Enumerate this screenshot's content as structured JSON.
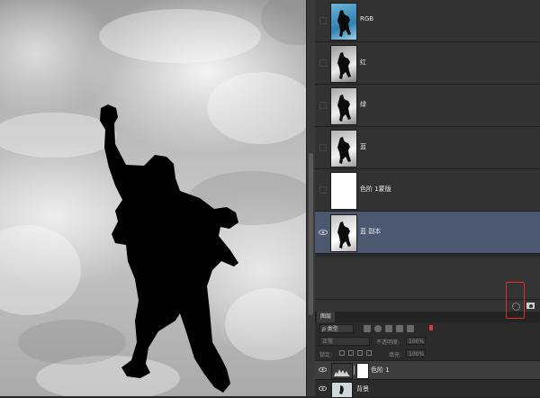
{
  "channels": [
    {
      "name": "RGB",
      "visible": false,
      "selected": false
    },
    {
      "name": "红",
      "visible": false,
      "selected": false
    },
    {
      "name": "绿",
      "visible": false,
      "selected": false
    },
    {
      "name": "蓝",
      "visible": false,
      "selected": false
    },
    {
      "name": "色阶 1蒙版",
      "visible": false,
      "selected": false
    },
    {
      "name": "蓝 副本",
      "visible": true,
      "selected": true
    }
  ],
  "layers_panel": {
    "tab_label": "图层",
    "filter_kind": "ρ 类型",
    "blend_mode": "正常",
    "opacity_label": "不透明度:",
    "opacity_value": "100%",
    "lock_label": "锁定:",
    "fill_label": "填充:",
    "fill_value": "100%",
    "layers": [
      {
        "name": "色阶 1",
        "selected": true
      },
      {
        "name": "背景",
        "selected": false
      }
    ]
  },
  "highlight_color": "#e52b2b"
}
